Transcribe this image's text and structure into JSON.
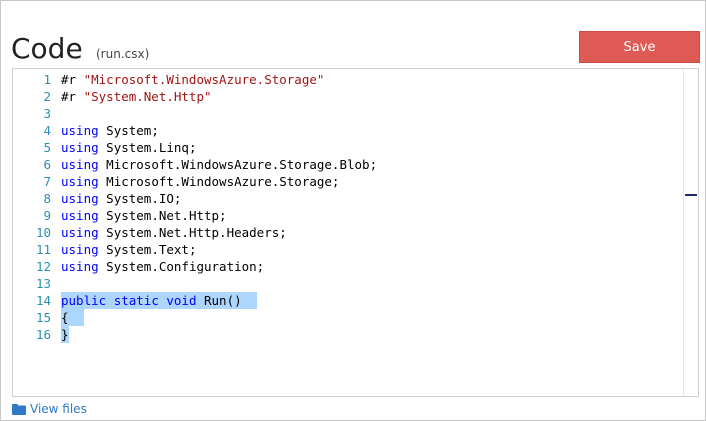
{
  "header": {
    "title": "Code",
    "filename": "(run.csx)",
    "save_label": "Save"
  },
  "editor": {
    "lines": [
      {
        "num": "1",
        "tokens": [
          {
            "t": "#r ",
            "c": "plain"
          },
          {
            "t": "\"Microsoft.WindowsAzure.Storage\"",
            "c": "str"
          }
        ]
      },
      {
        "num": "2",
        "tokens": [
          {
            "t": "#r ",
            "c": "plain"
          },
          {
            "t": "\"System.Net.Http\"",
            "c": "str"
          }
        ]
      },
      {
        "num": "3",
        "tokens": []
      },
      {
        "num": "4",
        "tokens": [
          {
            "t": "using",
            "c": "kw"
          },
          {
            "t": " System;",
            "c": "plain"
          }
        ]
      },
      {
        "num": "5",
        "tokens": [
          {
            "t": "using",
            "c": "kw"
          },
          {
            "t": " System.Linq;",
            "c": "plain"
          }
        ]
      },
      {
        "num": "6",
        "tokens": [
          {
            "t": "using",
            "c": "kw"
          },
          {
            "t": " Microsoft.WindowsAzure.Storage.Blob;",
            "c": "plain"
          }
        ]
      },
      {
        "num": "7",
        "tokens": [
          {
            "t": "using",
            "c": "kw"
          },
          {
            "t": " Microsoft.WindowsAzure.Storage;",
            "c": "plain"
          }
        ]
      },
      {
        "num": "8",
        "tokens": [
          {
            "t": "using",
            "c": "kw"
          },
          {
            "t": " System.IO;",
            "c": "plain"
          }
        ]
      },
      {
        "num": "9",
        "tokens": [
          {
            "t": "using",
            "c": "kw"
          },
          {
            "t": " System.Net.Http;",
            "c": "plain"
          }
        ]
      },
      {
        "num": "10",
        "tokens": [
          {
            "t": "using",
            "c": "kw"
          },
          {
            "t": " System.Net.Http.Headers;",
            "c": "plain"
          }
        ]
      },
      {
        "num": "11",
        "tokens": [
          {
            "t": "using",
            "c": "kw"
          },
          {
            "t": " System.Text;",
            "c": "plain"
          }
        ]
      },
      {
        "num": "12",
        "tokens": [
          {
            "t": "using",
            "c": "kw"
          },
          {
            "t": " System.Configuration;",
            "c": "plain"
          }
        ]
      },
      {
        "num": "13",
        "tokens": []
      },
      {
        "num": "14",
        "selected": true,
        "tokens": [
          {
            "t": "public",
            "c": "kw"
          },
          {
            "t": " ",
            "c": "plain"
          },
          {
            "t": "static",
            "c": "kw"
          },
          {
            "t": " ",
            "c": "plain"
          },
          {
            "t": "void",
            "c": "kw"
          },
          {
            "t": " Run()  ",
            "c": "plain"
          }
        ]
      },
      {
        "num": "15",
        "selected": true,
        "tokens": [
          {
            "t": "{  ",
            "c": "plain"
          }
        ]
      },
      {
        "num": "16",
        "selected": true,
        "tokens": [
          {
            "t": "}",
            "c": "plain"
          }
        ]
      }
    ]
  },
  "footer": {
    "view_files_label": "View files"
  },
  "colors": {
    "save_button": "#e05a55",
    "keyword": "#0000ff",
    "string": "#a31515",
    "line_number": "#2b91af",
    "selection": "#add6ff",
    "link": "#2f79c6"
  },
  "icons": {
    "view_files": "folder-icon"
  }
}
